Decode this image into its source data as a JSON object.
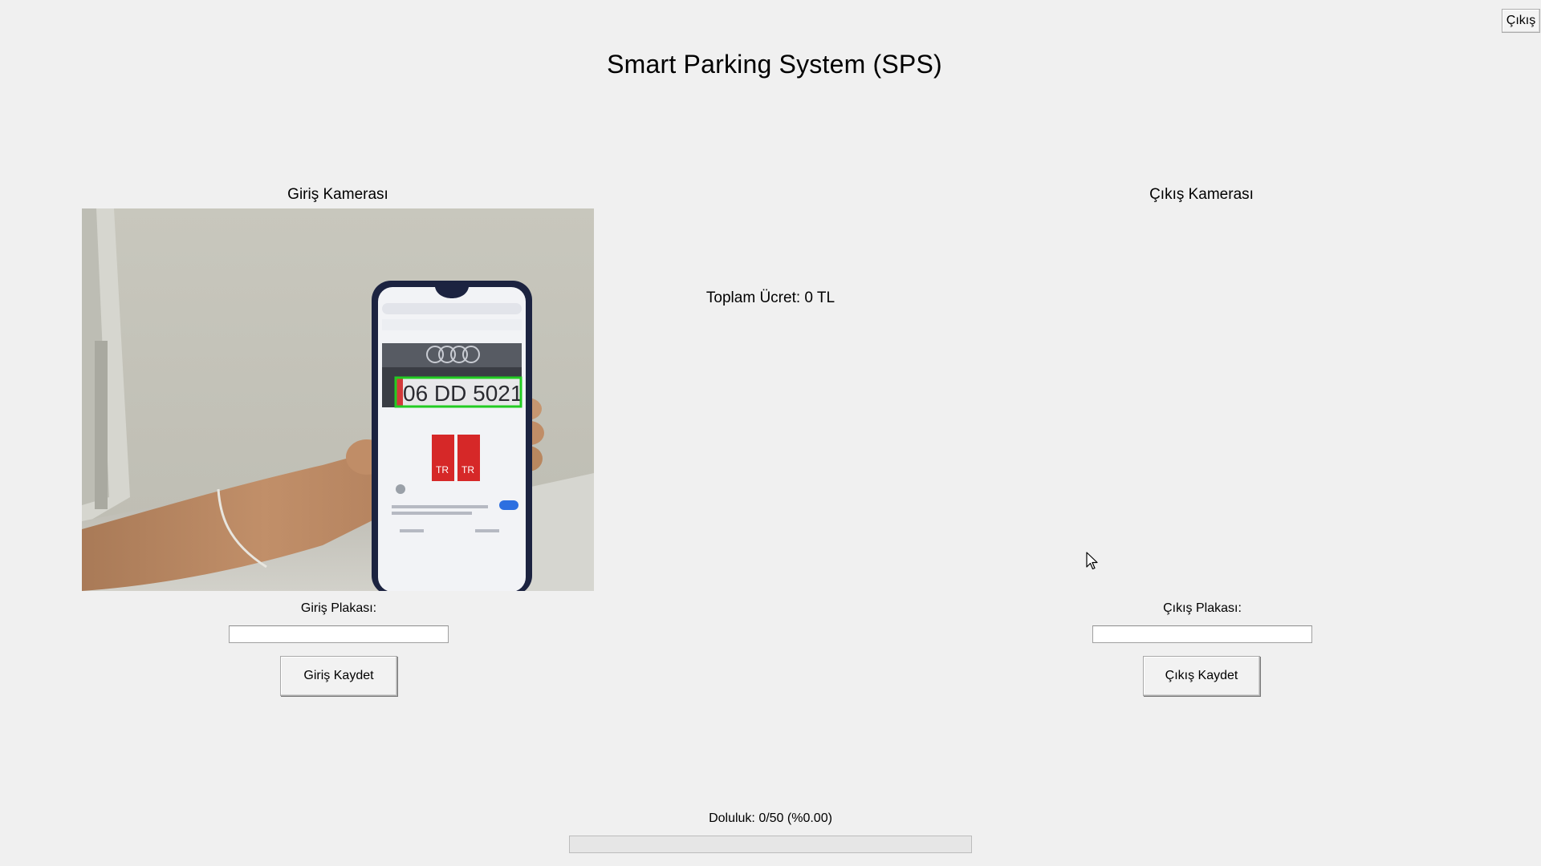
{
  "window": {
    "exit_button_label": "Çıkış"
  },
  "header": {
    "title": "Smart Parking System (SPS)"
  },
  "entry": {
    "camera_label": "Giriş Kamerası",
    "plate_label": "Giriş Plakası:",
    "plate_value": "",
    "save_label": "Giriş Kaydet",
    "camera_feed": {
      "detected_plate_text": "06 DD 5021",
      "detection_box_color": "#22cc22"
    }
  },
  "exit": {
    "camera_label": "Çıkış Kamerası",
    "plate_label": "Çıkış Plakası:",
    "plate_value": "",
    "save_label": "Çıkış Kaydet"
  },
  "fee": {
    "total_text": "Toplam Ücret: 0 TL"
  },
  "occupancy": {
    "label": "Doluluk: 0/50 (%0.00)",
    "occupied": 0,
    "capacity": 50,
    "fraction": 0.0
  },
  "colors": {
    "background": "#f0f0f0",
    "progress_fill": "#06b025"
  }
}
